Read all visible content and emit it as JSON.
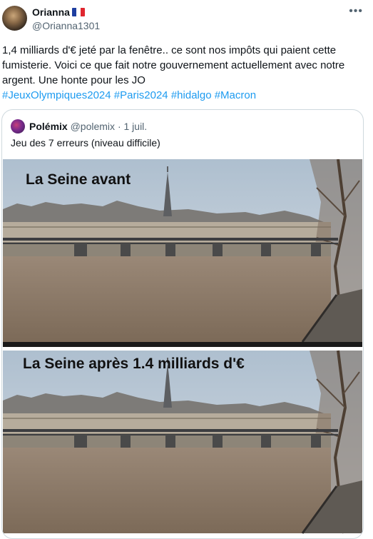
{
  "author": {
    "name": "Orianna",
    "flag_icon": "flag-france-icon",
    "handle": "@Orianna1301"
  },
  "more_icon": "more-horizontal-icon",
  "tweet": {
    "text": "1,4 milliards d'€ jeté par la fenêtre.. ce sont nos impôts qui paient cette fumisterie. Voici ce que fait notre gouvernement actuellement avec notre argent. Une honte pour les JO",
    "hashtags": [
      "#JeuxOlympiques2024",
      "#Paris2024",
      "#hidalgo",
      "#Macron"
    ]
  },
  "quote": {
    "name": "Polémix",
    "handle": "@polemix",
    "separator": "·",
    "date": "1 juil.",
    "text": "Jeu des 7 erreurs (niveau difficile)",
    "image_top_caption": "La Seine avant",
    "image_bottom_caption": "La Seine après 1.4 milliards d'€"
  },
  "colors": {
    "link": "#1d9bf0",
    "secondary_text": "#536471",
    "border": "#cfd9de",
    "river": "#8a7662",
    "sky": "#c3d0dc"
  }
}
